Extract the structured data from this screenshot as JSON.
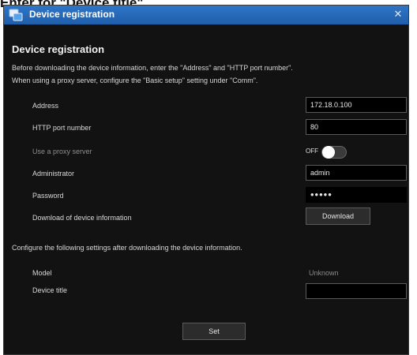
{
  "page_caption": "Enter for \"Device title\".",
  "window": {
    "title": "Device registration",
    "close_glyph": "✕"
  },
  "content": {
    "heading": "Device registration",
    "description_line1": "Before downloading the device information, enter the \"Address\" and \"HTTP port number\".",
    "description_line2": "When using a proxy server, configure the \"Basic setup\" setting under \"Comm\".",
    "address_label": "Address",
    "address_value": "172.18.0.100",
    "http_port_label": "HTTP port number",
    "http_port_value": "80",
    "proxy_label": "Use a proxy server",
    "proxy_state": "OFF",
    "administrator_label": "Administrator",
    "administrator_value": "admin",
    "password_label": "Password",
    "password_value": "•••••",
    "download_label": "Download of device information",
    "download_button": "Download",
    "configure_note": "Configure the following settings after downloading the device information.",
    "model_label": "Model",
    "model_value": "Unknown",
    "device_title_label": "Device title",
    "device_title_value": "",
    "set_button": "Set"
  },
  "colors": {
    "titlebar": "#2f76c7",
    "window_bg": "#121212",
    "field_bg": "#000000",
    "button_bg": "#2c2c2c"
  },
  "icons": {
    "app": "app-icon",
    "close": "close-icon"
  }
}
